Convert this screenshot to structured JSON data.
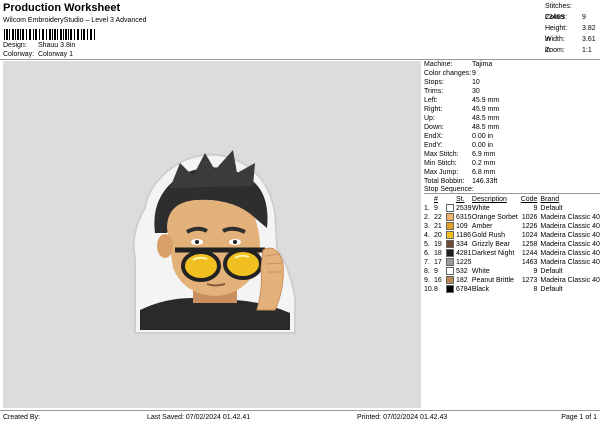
{
  "header": {
    "title": "Production Worksheet",
    "subtitle": "Wilcom EmbroideryStudio – Level 3 Advanced",
    "design_label": "Design:",
    "design_value": "Shauu 3.8in",
    "colorway_label": "Colorway:",
    "colorway_value": "Colorway 1"
  },
  "stats": [
    {
      "label": "Stitches:",
      "value": "23469"
    },
    {
      "label": "Colors:",
      "value": "9"
    },
    {
      "label": "Height:",
      "value": "3.82 in"
    },
    {
      "label": "Width:",
      "value": "3.61 in"
    },
    {
      "label": "Zoom:",
      "value": "1:1"
    }
  ],
  "machine_info": [
    {
      "label": "Machine:",
      "value": "Tajima"
    },
    {
      "label": "Color changes:",
      "value": "9"
    },
    {
      "label": "Stops:",
      "value": "10"
    },
    {
      "label": "Trims:",
      "value": "30"
    },
    {
      "label": "Left:",
      "value": "45.9 mm"
    },
    {
      "label": "Right:",
      "value": "45.9 mm"
    },
    {
      "label": "Up:",
      "value": "48.5 mm"
    },
    {
      "label": "Down:",
      "value": "48.5 mm"
    },
    {
      "label": "EndX:",
      "value": "0.00 in"
    },
    {
      "label": "EndY:",
      "value": "0.00 in"
    },
    {
      "label": "Max Stitch:",
      "value": "6.9 mm"
    },
    {
      "label": "Min Stitch:",
      "value": "0.2 mm"
    },
    {
      "label": "Max Jump:",
      "value": "6.8 mm"
    },
    {
      "label": "Total Bobbin:",
      "value": "146.33ft"
    }
  ],
  "stop_sequence": {
    "title": "Stop Sequence:",
    "headers": {
      "n": "#",
      "st": "St.",
      "desc": "Description",
      "code": "Code",
      "brand": "Brand"
    },
    "rows": [
      {
        "stop": "1.",
        "n": "9",
        "code_no": "2539",
        "desc": "White",
        "code": "9",
        "brand": "Default",
        "color": "#ffffff"
      },
      {
        "stop": "2.",
        "n": "22",
        "code_no": "6315",
        "desc": "Orange Sorbet",
        "code": "1026",
        "brand": "Madeira Classic 40",
        "color": "#f2b46a"
      },
      {
        "stop": "3.",
        "n": "21",
        "code_no": "109",
        "desc": "Amber",
        "code": "1226",
        "brand": "Madeira Classic 40",
        "color": "#e0a020"
      },
      {
        "stop": "4.",
        "n": "20",
        "code_no": "1186",
        "desc": "Gold Rush",
        "code": "1024",
        "brand": "Madeira Classic 40",
        "color": "#f0c020"
      },
      {
        "stop": "5.",
        "n": "19",
        "code_no": "334",
        "desc": "Grizzly Bear",
        "code": "1258",
        "brand": "Madeira Classic 40",
        "color": "#6e4b32"
      },
      {
        "stop": "6.",
        "n": "18",
        "code_no": "4281",
        "desc": "Darkest Night",
        "code": "1244",
        "brand": "Madeira Classic 40",
        "color": "#1f1f1f"
      },
      {
        "stop": "7.",
        "n": "17",
        "code_no": "1225",
        "desc": "",
        "code": "1463",
        "brand": "Madeira Classic 40",
        "color": "#9c9c9c"
      },
      {
        "stop": "8.",
        "n": "9",
        "code_no": "532",
        "desc": "White",
        "code": "9",
        "brand": "Default",
        "color": "#ffffff"
      },
      {
        "stop": "9.",
        "n": "16",
        "code_no": "182",
        "desc": "Peanut Brittle",
        "code": "1273",
        "brand": "Madeira Classic 40",
        "color": "#b58a52"
      },
      {
        "stop": "10.",
        "n": "8",
        "code_no": "6784",
        "desc": "Black",
        "code": "8",
        "brand": "Default",
        "color": "#000000"
      }
    ]
  },
  "footer": {
    "created": "Created By:",
    "saved": "Last Saved: 07/02/2024 01.42.41",
    "printed": "Printed: 07/02/2024 01.42.43",
    "page": "Page 1 of 1"
  }
}
